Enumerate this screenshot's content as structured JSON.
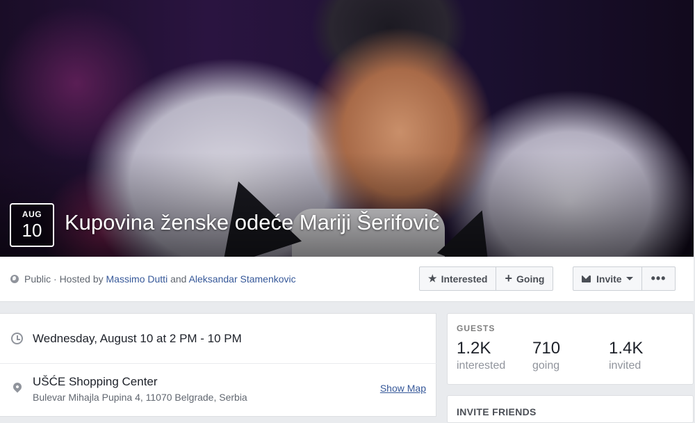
{
  "event": {
    "month": "AUG",
    "day": "10",
    "title": "Kupovina ženske odeće Mariji Šerifović"
  },
  "info": {
    "privacy": "Public · Hosted by ",
    "host1": "Massimo Dutti",
    "and": " and ",
    "host2": "Aleksandar Stamenkovic"
  },
  "actions": {
    "interested": "Interested",
    "going": "Going",
    "invite": "Invite",
    "more": "•••"
  },
  "details": {
    "datetime": "Wednesday, August 10 at 2 PM - 10 PM",
    "venue": "UŠĆE Shopping Center",
    "address": "Bulevar Mihajla Pupina 4, 11070 Belgrade, Serbia",
    "show_map": "Show Map"
  },
  "guests": {
    "label": "GUESTS",
    "interested_count": "1.2K",
    "interested_label": "interested",
    "going_count": "710",
    "going_label": "going",
    "invited_count": "1.4K",
    "invited_label": "invited"
  },
  "invite_friends": {
    "label": "INVITE FRIENDS"
  },
  "icons": [
    "globe-icon",
    "star-icon",
    "plus-icon",
    "envelope-icon",
    "caret-down-icon",
    "clock-icon",
    "map-pin-icon"
  ],
  "colors": {
    "link": "#365899",
    "text": "#1d2129",
    "muted": "#616770",
    "background": "#e9ebee"
  }
}
